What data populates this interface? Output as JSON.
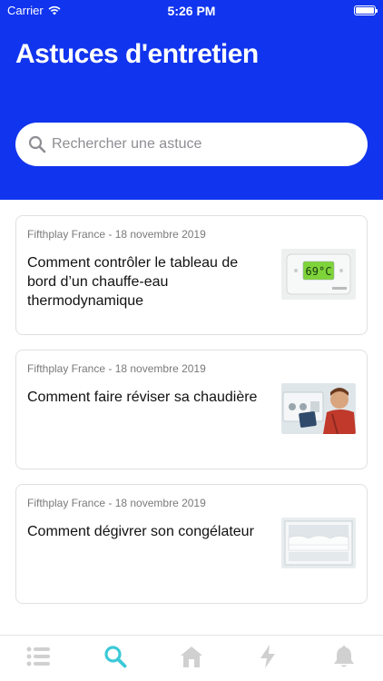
{
  "status": {
    "carrier": "Carrier",
    "time": "5:26 PM"
  },
  "header": {
    "title": "Astuces d'entretien"
  },
  "search": {
    "placeholder": "Rechercher une astuce"
  },
  "articles": [
    {
      "meta": "Fifthplay France - 18 novembre 2019",
      "title": "Comment contrôler le tableau de bord d’un chauffe-eau thermodynamique",
      "thumb_text": "69°C"
    },
    {
      "meta": "Fifthplay France - 18 novembre 2019",
      "title": "Comment faire réviser sa chaudière"
    },
    {
      "meta": "Fifthplay France - 18 novembre 2019",
      "title": "Comment dégivrer son congélateur"
    }
  ],
  "tabbar": {
    "items": [
      "list-icon",
      "search-icon",
      "home-icon",
      "bolt-icon",
      "bell-icon"
    ],
    "active": "search-icon"
  },
  "colors": {
    "brand_blue": "#1134ee",
    "accent_teal": "#3cc9d8",
    "inactive_icon": "#d0d0d0"
  }
}
